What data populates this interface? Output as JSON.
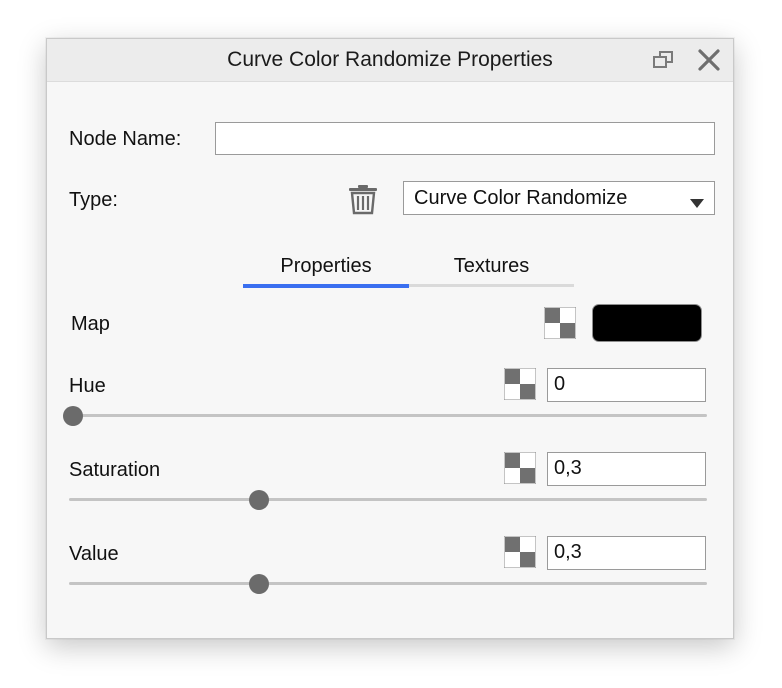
{
  "window": {
    "title": "Curve Color Randomize Properties",
    "restore_icon": "restore-window-icon",
    "close_icon": "close-icon"
  },
  "form": {
    "node_name_label": "Node Name:",
    "node_name_value": "",
    "type_label": "Type:",
    "type_value": "Curve Color Randomize",
    "delete_icon": "trash-icon"
  },
  "tabs": [
    {
      "label": "Properties",
      "active": true
    },
    {
      "label": "Textures",
      "active": false
    }
  ],
  "accent_color": "#3a6ff0",
  "properties": {
    "map": {
      "label": "Map",
      "color": "#000000"
    },
    "hue": {
      "label": "Hue",
      "value": "0",
      "slider_fraction": 0.0
    },
    "saturation": {
      "label": "Saturation",
      "value": "0,3",
      "slider_fraction": 0.3
    },
    "value": {
      "label": "Value",
      "value": "0,3",
      "slider_fraction": 0.3
    }
  }
}
